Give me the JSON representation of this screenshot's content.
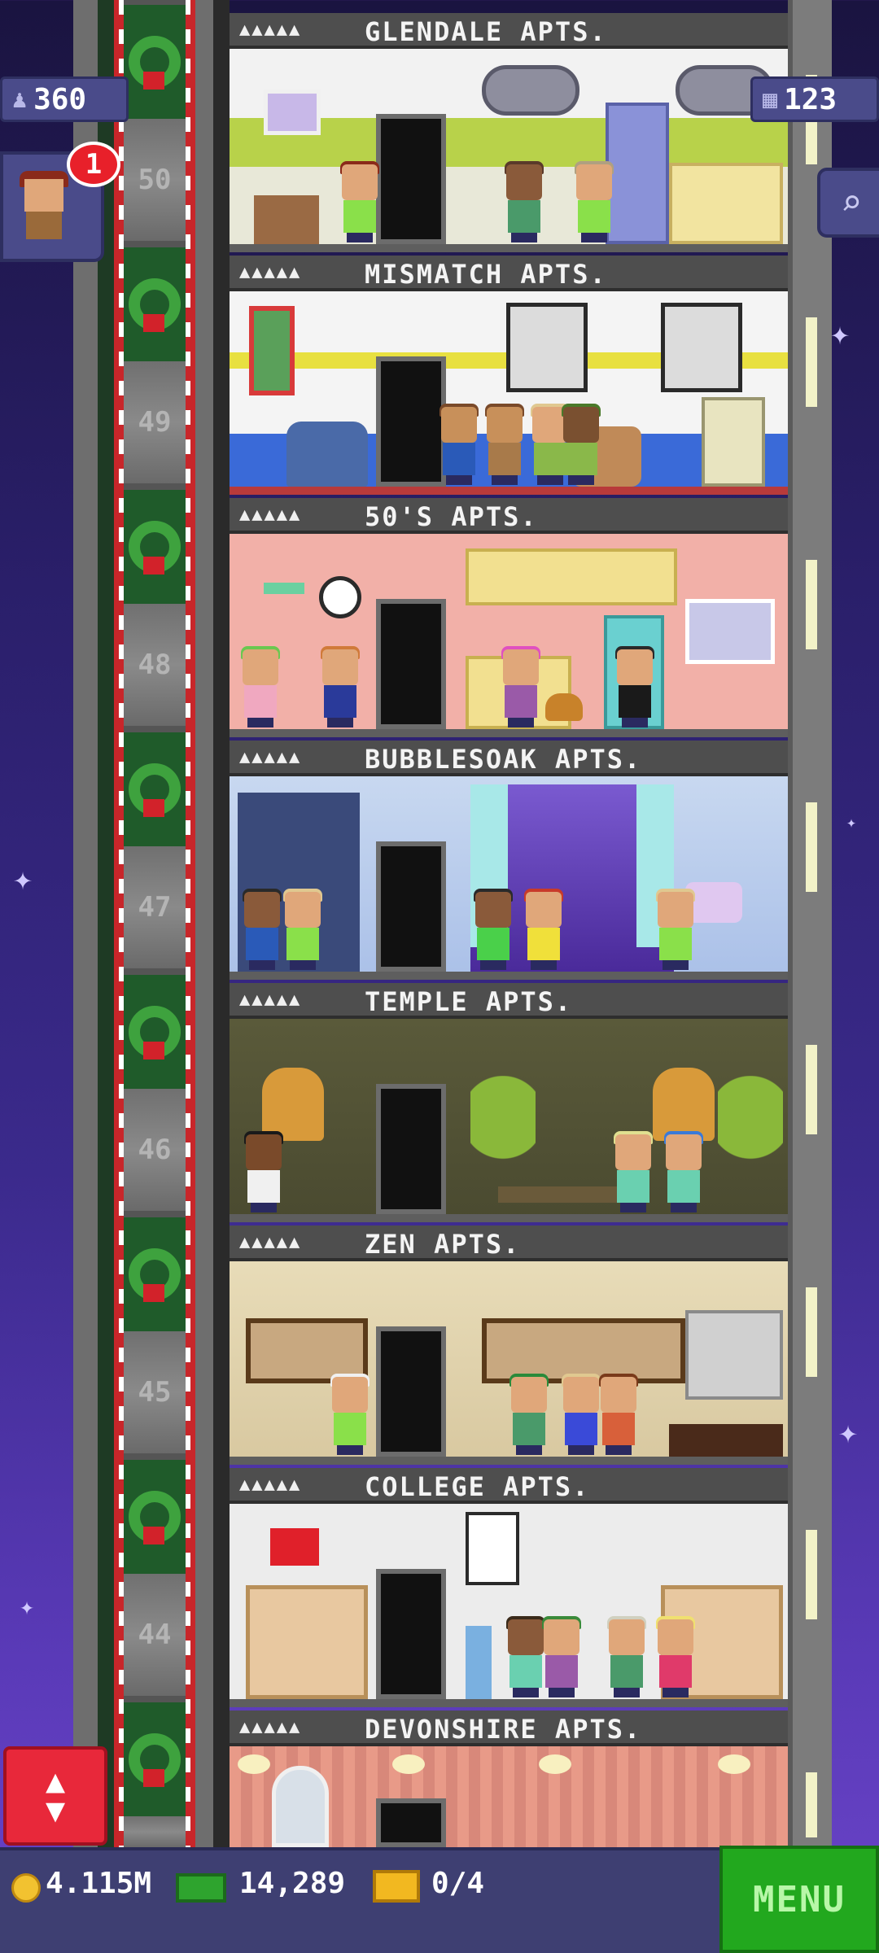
{
  "hud": {
    "residents": "360",
    "floors_count": "123",
    "visitor_badge": "1",
    "coins": "4.115M",
    "bux": "14,289",
    "tickets": "0/4",
    "menu_label": "MENU",
    "resident_icon": "person-icon",
    "floors_icon": "building-icon",
    "search_icon": "magnifier-icon",
    "elevator_icon": "up-down-arrows-icon"
  },
  "floors": [
    {
      "name": "GLENDALE APTS.",
      "number": "50",
      "stars": "▲▲▲▲▲"
    },
    {
      "name": "MISMATCH APTS.",
      "number": "49",
      "stars": "▲▲▲▲▲"
    },
    {
      "name": "50'S APTS.",
      "number": "48",
      "stars": "▲▲▲▲▲"
    },
    {
      "name": "BUBBLESOAK APTS.",
      "number": "47",
      "stars": "▲▲▲▲▲"
    },
    {
      "name": "TEMPLE APTS.",
      "number": "46",
      "stars": "▲▲▲▲▲"
    },
    {
      "name": "ZEN APTS.",
      "number": "45",
      "stars": "▲▲▲▲▲"
    },
    {
      "name": "COLLEGE APTS.",
      "number": "44",
      "stars": "▲▲▲▲▲"
    },
    {
      "name": "DEVONSHIRE APTS.",
      "number": "",
      "stars": "▲▲▲▲▲"
    }
  ],
  "colors": {
    "sky": "#3b2a8c",
    "shaft_red": "#c8262a",
    "menu_green": "#22a81e",
    "hud_panel": "#4a4b8a"
  }
}
